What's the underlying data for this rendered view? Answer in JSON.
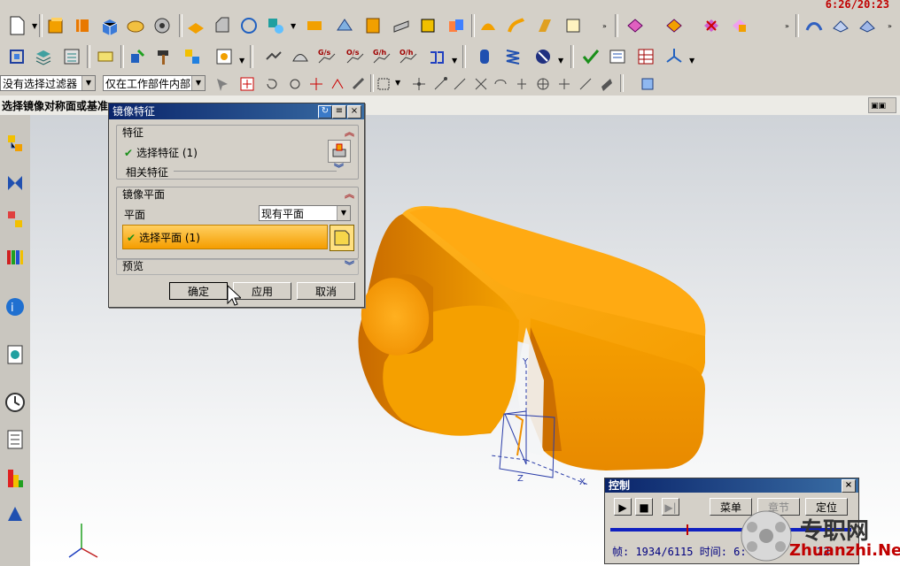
{
  "clock": "6:26/20:23",
  "filters": {
    "selection_filter": "没有选择过滤器",
    "scope": "仅在工作部件内部"
  },
  "status_prompt": "选择镜像对称面或基准",
  "mirror_dialog": {
    "title": "镜像特征",
    "feature_group": {
      "header": "特征",
      "select_feature": "选择特征 (1)",
      "related_features": "相关特征"
    },
    "plane_group": {
      "header": "镜像平面",
      "plane_label": "平面",
      "plane_option": "现有平面",
      "select_plane": "选择平面 (1)"
    },
    "preview": "预览",
    "buttons": {
      "ok": "确定",
      "apply": "应用",
      "cancel": "取消"
    }
  },
  "control_panel": {
    "title": "控制",
    "menu": "菜单",
    "chapter": "章节",
    "locate": "定位",
    "frame_info": "帧: 1934/6115 时间: 6:",
    "frame_tail": "23",
    "progress": 0.316
  },
  "axes": {
    "x": "X",
    "y": "Y",
    "z": "Z"
  },
  "watermark": {
    "brand": "专职网",
    "url": "Zhuanzhi.Net"
  },
  "colors": {
    "part_orange": "#f5a300",
    "title_blue": "#0a246a",
    "check_green": "#1a8f1a"
  }
}
